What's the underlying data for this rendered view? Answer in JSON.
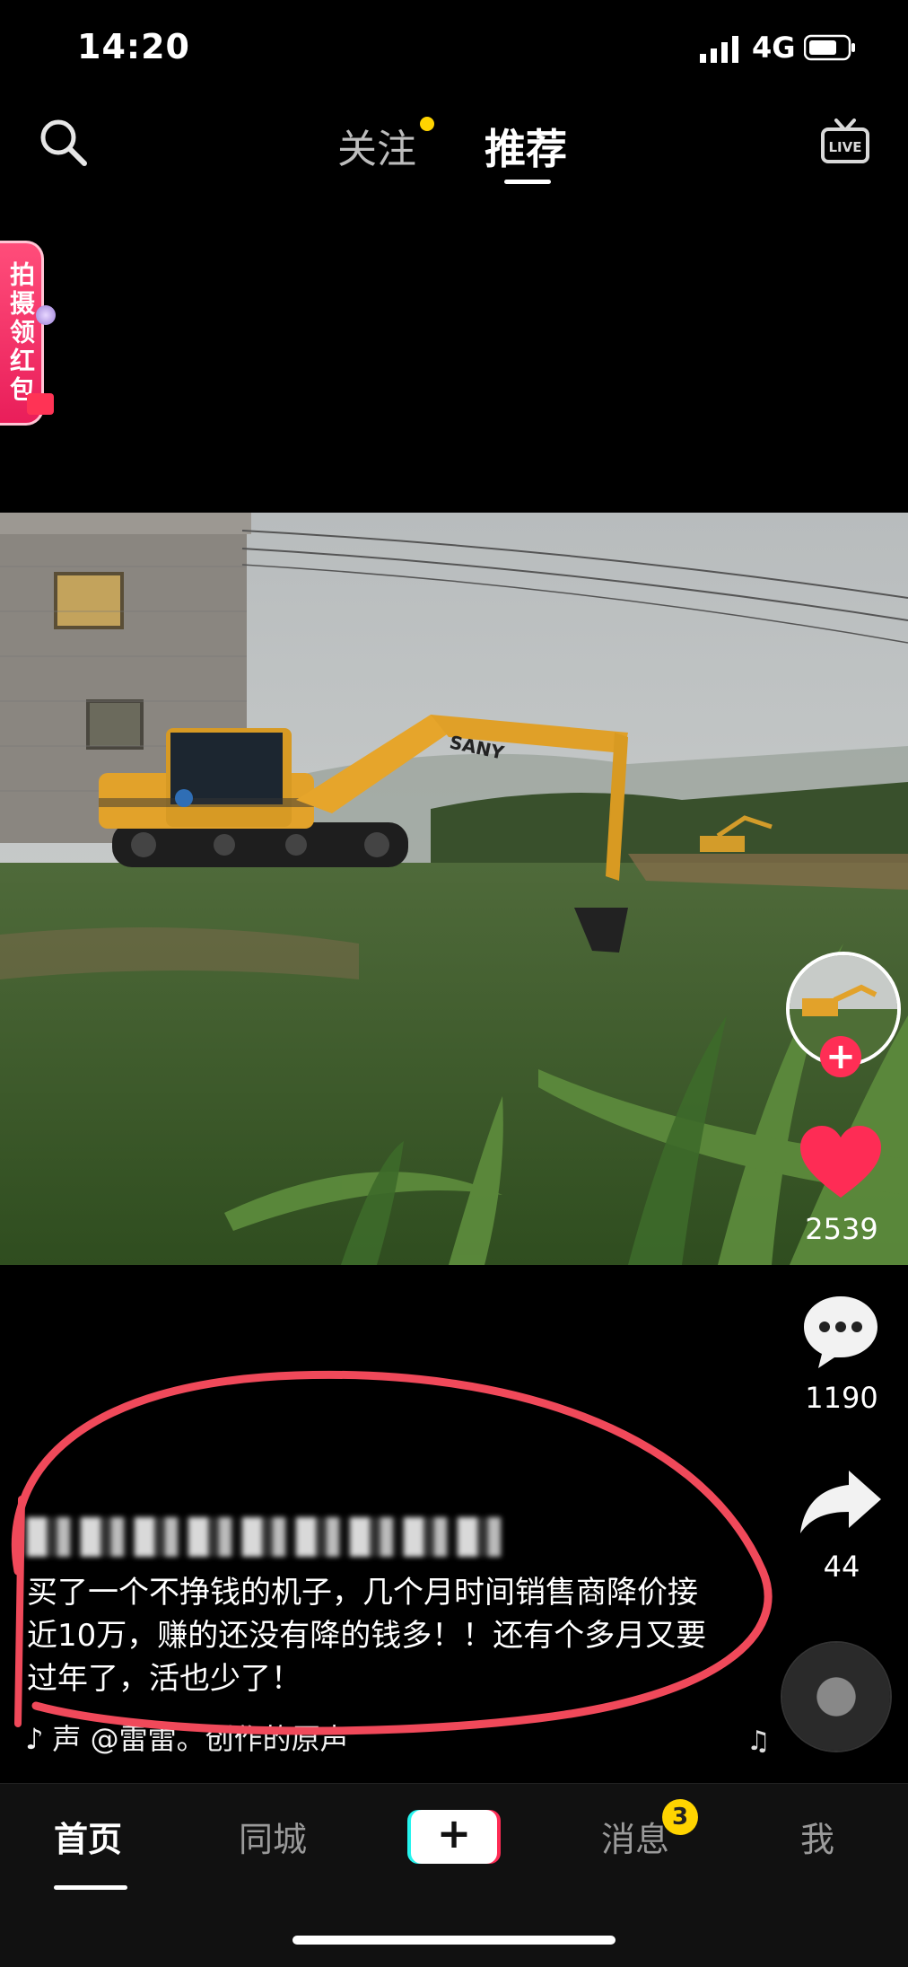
{
  "status_bar": {
    "time": "14:20",
    "network": "4G"
  },
  "top_nav": {
    "follow_tab": "关注",
    "recommend_tab": "推荐"
  },
  "red_packet": {
    "label": "拍摄领红包"
  },
  "video": {
    "brand_text": "SANY",
    "description": "excavator in grassy field near building on cloudy day"
  },
  "actions": {
    "likes": "2539",
    "comments": "1190",
    "shares": "44"
  },
  "post": {
    "author": "",
    "caption": "买了一个不挣钱的机子，几个月时间销售商降价接近10万，赚的还没有降的钱多！！还有个多月又要过年了，活也少了！",
    "music": "声    @雷雷。创作的原声"
  },
  "bottom_nav": {
    "home": "首页",
    "city": "同城",
    "create": "+",
    "messages": "消息",
    "messages_badge": "3",
    "me": "我"
  },
  "colors": {
    "accent": "#ff2e55",
    "badge": "#ffd400",
    "annotation": "#f0495a"
  }
}
